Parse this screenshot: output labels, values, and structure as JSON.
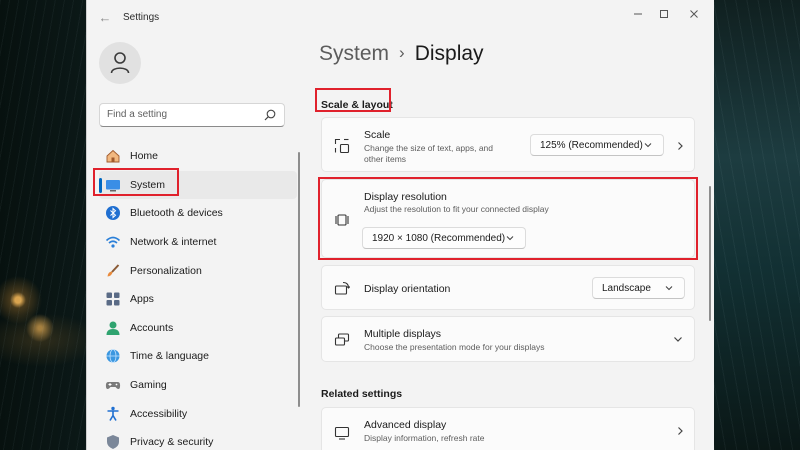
{
  "window": {
    "title": "Settings",
    "controls": [
      "minimize",
      "maximize",
      "close"
    ]
  },
  "search": {
    "placeholder": "Find a setting"
  },
  "sidebar": {
    "items": [
      {
        "label": "Home",
        "icon": "home-icon",
        "active": false
      },
      {
        "label": "System",
        "icon": "system-icon",
        "active": true
      },
      {
        "label": "Bluetooth & devices",
        "icon": "bluetooth-icon",
        "active": false
      },
      {
        "label": "Network & internet",
        "icon": "wifi-icon",
        "active": false
      },
      {
        "label": "Personalization",
        "icon": "brush-icon",
        "active": false
      },
      {
        "label": "Apps",
        "icon": "apps-icon",
        "active": false
      },
      {
        "label": "Accounts",
        "icon": "accounts-icon",
        "active": false
      },
      {
        "label": "Time & language",
        "icon": "globe-clock-icon",
        "active": false
      },
      {
        "label": "Gaming",
        "icon": "gamepad-icon",
        "active": false
      },
      {
        "label": "Accessibility",
        "icon": "accessibility-icon",
        "active": false
      },
      {
        "label": "Privacy & security",
        "icon": "shield-icon",
        "active": false
      }
    ]
  },
  "breadcrumb": {
    "parent": "System",
    "separator": "›",
    "current": "Display"
  },
  "sections": {
    "scale_layout": "Scale & layout",
    "related": "Related settings"
  },
  "settings": {
    "scale": {
      "title": "Scale",
      "desc_line1": "Change the size of text, apps, and",
      "desc_line2": "other items",
      "value": "125% (Recommended)"
    },
    "resolution": {
      "title": "Display resolution",
      "desc": "Adjust the resolution to fit your connected display",
      "value": "1920 × 1080 (Recommended)"
    },
    "orientation": {
      "title": "Display orientation",
      "value": "Landscape"
    },
    "multiple": {
      "title": "Multiple displays",
      "desc": "Choose the presentation mode for your displays"
    },
    "advanced": {
      "title": "Advanced display",
      "desc": "Display information, refresh rate"
    }
  },
  "colors": {
    "accent": "#0067c0",
    "highlight_box": "#e0212c",
    "window_bg": "#f3f3f3",
    "card_bg": "#fbfbfb"
  }
}
